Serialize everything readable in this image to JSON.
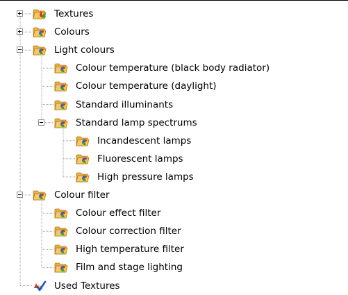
{
  "tree": {
    "items": [
      {
        "label": "Textures",
        "level": 0,
        "expander": "collapsed",
        "icon": "folder-textures-icon"
      },
      {
        "label": "Colours",
        "level": 0,
        "expander": "collapsed",
        "icon": "folder-colours-icon"
      },
      {
        "label": "Light colours",
        "level": 0,
        "expander": "expanded",
        "icon": "folder-colours-icon"
      },
      {
        "label": "Colour temperature (black body radiator)",
        "level": 1,
        "expander": "none",
        "icon": "folder-colours-icon"
      },
      {
        "label": "Colour temperature (daylight)",
        "level": 1,
        "expander": "none",
        "icon": "folder-colours-icon"
      },
      {
        "label": "Standard illuminants",
        "level": 1,
        "expander": "none",
        "icon": "folder-colours-icon"
      },
      {
        "label": "Standard lamp spectrums",
        "level": 1,
        "expander": "expanded",
        "icon": "folder-colours-icon"
      },
      {
        "label": "Incandescent lamps",
        "level": 2,
        "expander": "none",
        "icon": "folder-colours-icon"
      },
      {
        "label": "Fluorescent lamps",
        "level": 2,
        "expander": "none",
        "icon": "folder-colours-icon"
      },
      {
        "label": "High pressure lamps",
        "level": 2,
        "expander": "none",
        "icon": "folder-colours-icon"
      },
      {
        "label": "Colour filter",
        "level": 0,
        "expander": "expanded",
        "icon": "folder-colours-icon"
      },
      {
        "label": "Colour effect filter",
        "level": 1,
        "expander": "none",
        "icon": "folder-colours-icon"
      },
      {
        "label": "Colour correction filter",
        "level": 1,
        "expander": "none",
        "icon": "folder-colours-icon"
      },
      {
        "label": "High temperature filter",
        "level": 1,
        "expander": "none",
        "icon": "folder-colours-icon"
      },
      {
        "label": "Film and stage lighting",
        "level": 1,
        "expander": "none",
        "icon": "folder-colours-icon"
      },
      {
        "label": "Used Textures",
        "level": 0,
        "expander": "none",
        "icon": "checkmark-textures-icon"
      }
    ]
  },
  "colors": {
    "folder": "#e8b04a",
    "folder_dark": "#b07818",
    "swatch_red": "#e03020",
    "swatch_yellow": "#f0d020",
    "swatch_green": "#38a030",
    "check_blue": "#2050d0",
    "tree_line": "#a0a0a0",
    "expander_border": "#8a8a8a"
  }
}
